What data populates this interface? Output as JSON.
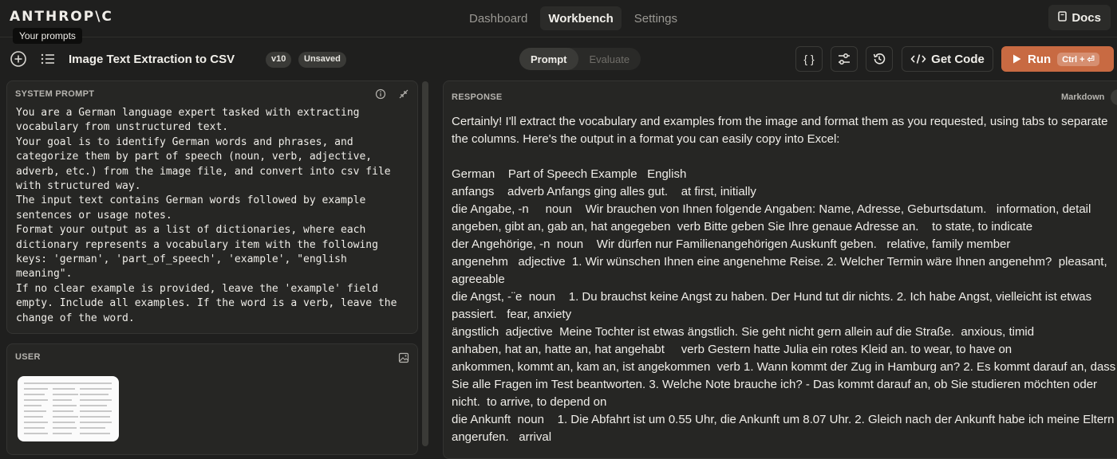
{
  "nav": {
    "logo": "ANTHROP\\C",
    "tabs": [
      {
        "label": "Dashboard",
        "active": false
      },
      {
        "label": "Workbench",
        "active": true
      },
      {
        "label": "Settings",
        "active": false
      }
    ],
    "docs_label": "Docs"
  },
  "tooltip": "Your prompts",
  "toolbar": {
    "prompt_title": "Image Text Extraction to CSV",
    "version_badge": "v10",
    "status_badge": "Unsaved",
    "mode_prompt": "Prompt",
    "mode_evaluate": "Evaluate",
    "variables_icon": "{ }",
    "get_code_label": "Get Code",
    "run_label": "Run",
    "run_shortcut": "Ctrl + ⏎"
  },
  "system_prompt": {
    "label": "SYSTEM PROMPT",
    "text": "You are a German language expert tasked with extracting vocabulary from unstructured text.\nYour goal is to identify German words and phrases, and categorize them by part of speech (noun, verb, adjective, adverb, etc.) from the image file, and convert into csv file with structured way.\nThe input text contains German words followed by example sentences or usage notes.\nFormat your output as a list of dictionaries, where each dictionary represents a vocabulary item with the following keys: 'german', 'part_of_speech', 'example', \"english meaning\".\nIf no clear example is provided, leave the 'example' field empty. Include all examples. If the word is a verb, leave the change of the word."
  },
  "user": {
    "label": "USER"
  },
  "response": {
    "label": "RESPONSE",
    "format": "Markdown",
    "text": "Certainly! I'll extract the vocabulary and examples from the image and format them as you requested, using tabs to separate the columns. Here's the output in a format you can easily copy into Excel:\n\nGerman    Part of Speech Example   English\nanfangs    adverb Anfangs ging alles gut.    at first, initially\ndie Angabe, -n     noun    Wir brauchen von Ihnen folgende Angaben: Name, Adresse, Geburtsdatum.   information, detail\nangeben, gibt an, gab an, hat angegeben  verb Bitte geben Sie Ihre genaue Adresse an.    to state, to indicate\nder Angehörige, -n  noun    Wir dürfen nur Familienangehörigen Auskunft geben.   relative, family member\nangenehm   adjective  1. Wir wünschen Ihnen eine angenehme Reise. 2. Welcher Termin wäre Ihnen angenehm?  pleasant, agreeable\ndie Angst, -¨e  noun    1. Du brauchst keine Angst zu haben. Der Hund tut dir nichts. 2. Ich habe Angst, vielleicht ist etwas passiert.   fear, anxiety\nängstlich  adjective  Meine Tochter ist etwas ängstlich. Sie geht nicht gern allein auf die Straße.  anxious, timid\nanhaben, hat an, hatte an, hat angehabt     verb Gestern hatte Julia ein rotes Kleid an. to wear, to have on\nankommen, kommt an, kam an, ist angekommen  verb 1. Wann kommt der Zug in Hamburg an? 2. Es kommt darauf an, dass Sie alle Fragen im Test beantworten. 3. Welche Note brauche ich? - Das kommt darauf an, ob Sie studieren möchten oder nicht.  to arrive, to depend on\ndie Ankunft  noun    1. Die Abfahrt ist um 0.55 Uhr, die Ankunft um 8.07 Uhr. 2. Gleich nach der Ankunft habe ich meine Eltern angerufen.   arrival"
  },
  "colors": {
    "background": "#1f1f1e",
    "panel": "#262624",
    "accent_run": "#c86a42"
  }
}
